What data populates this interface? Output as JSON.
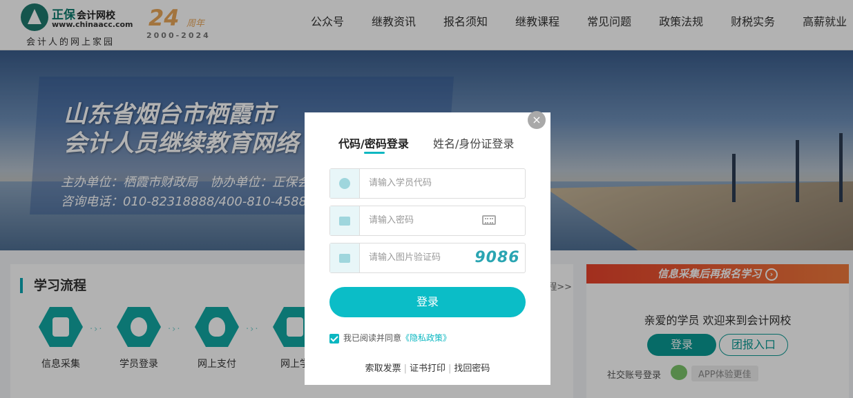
{
  "header": {
    "logo_name": "正保",
    "logo_name_suffix": "会计网校",
    "logo_url": "www.chinaacc.com",
    "slogan": "会计人的网上家园",
    "anniversary_number": "24",
    "anniversary_unit": "周年",
    "anniversary_years": "2000-2024",
    "nav": [
      "公众号",
      "继教资讯",
      "报名须知",
      "继教课程",
      "常见问题",
      "政策法规",
      "财税实务",
      "高薪就业"
    ]
  },
  "banner": {
    "title_line1": "山东省烟台市栖霞市",
    "title_line2": "会计人员继续教育网络",
    "sub_line1": "主办单位：栖霞市财政局　协办单位：正保会",
    "sub_line2": "咨询电话：010-82318888/400-810-4588"
  },
  "process": {
    "title": "学习流程",
    "more": "程>>",
    "steps": [
      "信息采集",
      "学员登录",
      "网上支付",
      "网上学"
    ]
  },
  "side": {
    "banner": "信息采集后再报名学习",
    "welcome": "亲爱的学员 欢迎来到会计网校",
    "login": "登录",
    "group": "团报入口",
    "social": "社交账号登录",
    "app": "APP体验更佳"
  },
  "modal": {
    "close": "×",
    "tab_code": "代码/密码登录",
    "tab_name": "姓名/身份证登录",
    "code_placeholder": "请输入学员代码",
    "password_placeholder": "请输入密码",
    "captcha_placeholder": "请输入图片验证码",
    "captcha_text": "9086",
    "submit": "登录",
    "agree_text": "我已阅读并同意",
    "privacy": "《隐私政策》",
    "links": [
      "索取发票",
      "证书打印",
      "找回密码"
    ]
  },
  "colors": {
    "accent": "#0bbdc7",
    "brand": "#0b7a6d",
    "side_banner": "#e8432c"
  }
}
